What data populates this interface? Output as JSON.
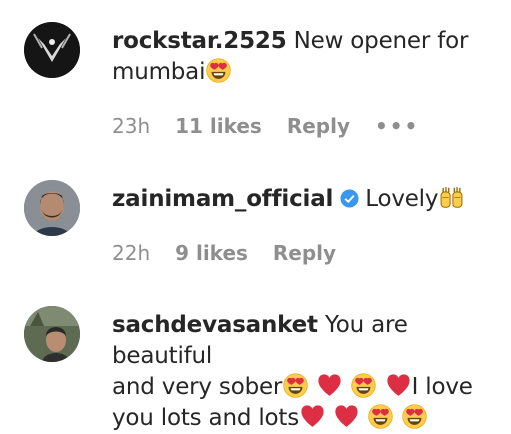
{
  "comments": [
    {
      "username": "rockstar.2525",
      "line1": "New opener for",
      "line2": "mumbai",
      "time": "23h",
      "likes": "11 likes",
      "reply": "Reply",
      "more": "•••"
    },
    {
      "username": "zainimam_official",
      "line1": "Lovely",
      "time": "22h",
      "likes": "9 likes",
      "reply": "Reply"
    },
    {
      "username": "sachdevasanket",
      "line1": "You are beautiful",
      "line2": "and very sober",
      "line2b": "I love",
      "line3": "you lots and lots"
    }
  ],
  "colors": {
    "text": "#262626",
    "meta": "#8e8e8e",
    "verified": "#3897f0",
    "heart": "#dd2e44",
    "emoji_face": "#ffcc4d"
  },
  "icons": [
    "heart-eyes-emoji",
    "red-heart-emoji",
    "raising-hands-emoji",
    "verified-badge-icon"
  ]
}
